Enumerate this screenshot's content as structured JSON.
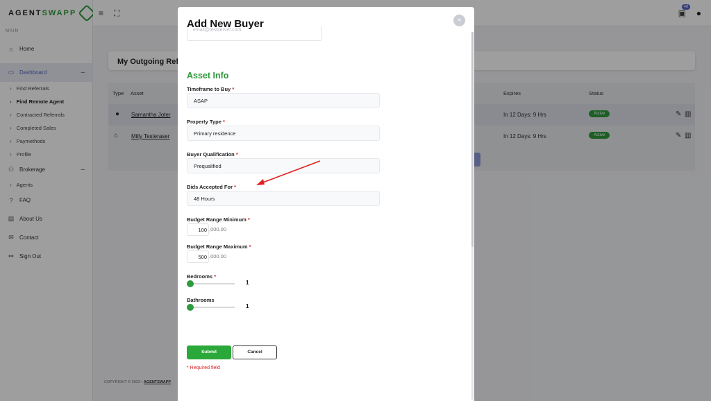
{
  "app": {
    "logo": {
      "part1": "AGENT",
      "part2": "SWAPP"
    },
    "section_label": "MAIN",
    "nav": {
      "home": "Home",
      "dashboard": "Dashboard",
      "dashboard_toggle": "–",
      "dashboard_sub": [
        "Find Referrals",
        "Find Remote Agent",
        "Contracted Referrals",
        "Completed Sales",
        "Paymethods",
        "Profile"
      ],
      "brokerage": "Brokerage",
      "brokerage_toggle": "–",
      "brokerage_sub": [
        "Agents"
      ],
      "faq": "FAQ",
      "about": "About Us",
      "contact": "Contact",
      "sign_out": "Sign Out"
    },
    "topbar": {
      "notification_count": "48"
    },
    "card_title": "My Outgoing Refer",
    "table": {
      "headers": {
        "type": "Type",
        "asset": "Asset",
        "expires": "Expires",
        "status": "Status"
      },
      "rows": [
        {
          "asset": "Samantha Joter",
          "expires": "In 12 Days: 9 Hrs",
          "status": "Active",
          "type_icon": "person-icon"
        },
        {
          "asset": "Milly Testeraser",
          "expires": "In 12 Days: 9 Hrs",
          "status": "Active",
          "type_icon": "home-icon"
        }
      ]
    },
    "footer": {
      "copyright": "COPYRIGHT © 2023 •",
      "brand": "AGENTSWAPP"
    }
  },
  "modal": {
    "title": "Add New Buyer",
    "close_label": "×",
    "email_partial": "email@testserver.com",
    "section_title": "Asset Info",
    "required_mark": "*",
    "fields": {
      "timeframe": {
        "label": "Timeframe to Buy",
        "value": "ASAP"
      },
      "property_type": {
        "label": "Property Type",
        "value": "Primary residence"
      },
      "qualification": {
        "label": "Buyer Qualification",
        "value": "Prequalified"
      },
      "bids": {
        "label": "Bids Accepted For",
        "value": "48 Hours"
      },
      "budget_min": {
        "label": "Budget Range Minimum",
        "value": "100",
        "suffix": ",000.00"
      },
      "budget_max": {
        "label": "Budget Range Maximum",
        "value": "500",
        "suffix": ",000.00"
      },
      "bedrooms": {
        "label": "Bedrooms",
        "value": "1"
      },
      "bathrooms": {
        "label": "Bathrooms",
        "value": "1"
      }
    },
    "submit_label": "Submit",
    "cancel_label": "Cancel",
    "required_note": "* Required field"
  },
  "colors": {
    "accent_green": "#2e9a3c",
    "dashboard_blue": "#5562c7",
    "annotation_red": "#e02020"
  }
}
